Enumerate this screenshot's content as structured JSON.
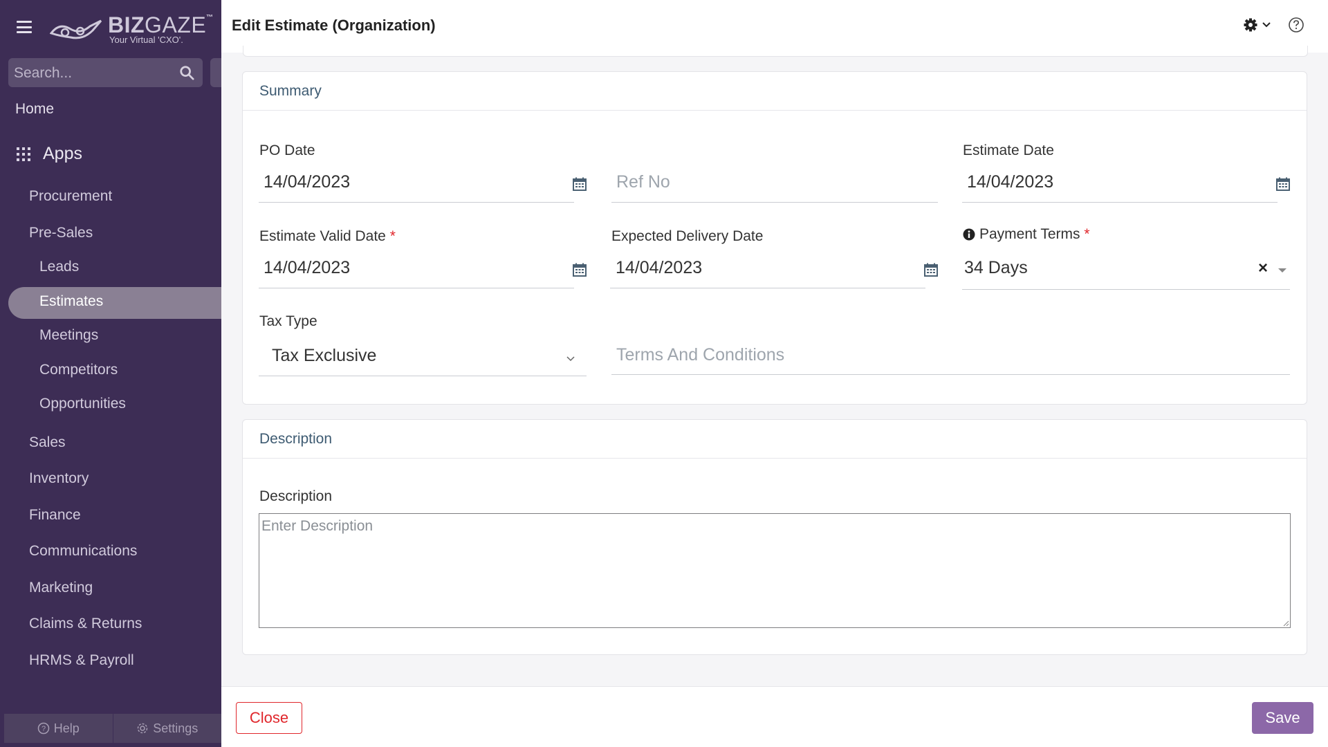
{
  "brand": {
    "name_bold": "BIZ",
    "name_thin": "GAZE",
    "tm": "™",
    "tagline": "Your Virtual 'CXO'."
  },
  "sidebar": {
    "search_placeholder": "Search...",
    "home": "Home",
    "apps": "Apps",
    "items": [
      {
        "label": "Procurement"
      },
      {
        "label": "Pre-Sales"
      },
      {
        "label": "Leads"
      },
      {
        "label": "Estimates",
        "active": true
      },
      {
        "label": "Meetings"
      },
      {
        "label": "Competitors"
      },
      {
        "label": "Opportunities"
      },
      {
        "label": "Sales"
      },
      {
        "label": "Inventory"
      },
      {
        "label": "Finance"
      },
      {
        "label": "Communications"
      },
      {
        "label": "Marketing"
      },
      {
        "label": "Claims & Returns"
      },
      {
        "label": "HRMS & Payroll"
      }
    ],
    "bottom": {
      "help": "Help",
      "settings": "Settings"
    }
  },
  "header": {
    "title": "Edit Estimate (Organization)"
  },
  "summary": {
    "title": "Summary",
    "po_date": {
      "label": "PO Date",
      "value": "14/04/2023"
    },
    "ref_no": {
      "placeholder": "Ref No"
    },
    "estimate_date": {
      "label": "Estimate Date",
      "value": "14/04/2023"
    },
    "estimate_valid_date": {
      "label": "Estimate Valid Date",
      "required": "*",
      "value": "14/04/2023"
    },
    "expected_delivery_date": {
      "label": "Expected Delivery Date",
      "value": "14/04/2023"
    },
    "payment_terms": {
      "label": "Payment Terms",
      "required": "*",
      "value": "34 Days",
      "clear": "×"
    },
    "tax_type": {
      "label": "Tax Type",
      "value": "Tax Exclusive"
    },
    "terms": {
      "placeholder": "Terms And Conditions"
    }
  },
  "description": {
    "title": "Description",
    "label": "Description",
    "placeholder": "Enter Description"
  },
  "footer": {
    "close": "Close",
    "save": "Save"
  },
  "colors": {
    "sidebar": "#3d2d55",
    "accent": "#8c68a8",
    "danger": "#e0262b",
    "section_title": "#3e5b72"
  }
}
